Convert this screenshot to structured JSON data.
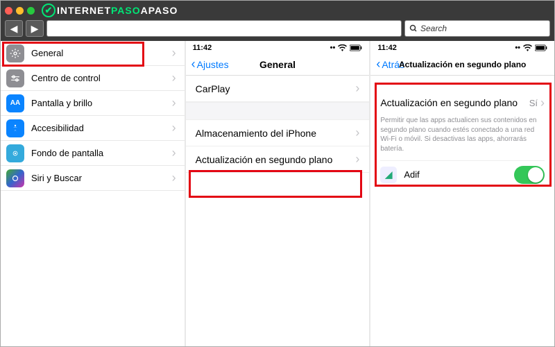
{
  "brand": {
    "a": "INTERNET",
    "b": "PASO",
    "c": "APASO"
  },
  "search": {
    "placeholder": "Search"
  },
  "col1": {
    "items": [
      {
        "label": "General"
      },
      {
        "label": "Centro de control"
      },
      {
        "label": "Pantalla y brillo"
      },
      {
        "label": "Accesibilidad"
      },
      {
        "label": "Fondo de pantalla"
      },
      {
        "label": "Siri y Buscar"
      }
    ]
  },
  "col2": {
    "time": "11:42",
    "back": "Ajustes",
    "title": "General",
    "rows": {
      "carplay": "CarPlay",
      "storage": "Almacenamiento del iPhone",
      "bgrefresh": "Actualización en segundo plano"
    }
  },
  "col3": {
    "time": "11:42",
    "back": "Atrás",
    "title": "Actualización en segundo plano",
    "setting_label": "Actualización en segundo plano",
    "setting_value": "Sí",
    "description": "Permitir que las apps actualicen sus contenidos en segundo plano cuando estés conectado a una red Wi-Fi o móvil. Si desactivas las apps, ahorrarás batería.",
    "app": "Adif"
  }
}
